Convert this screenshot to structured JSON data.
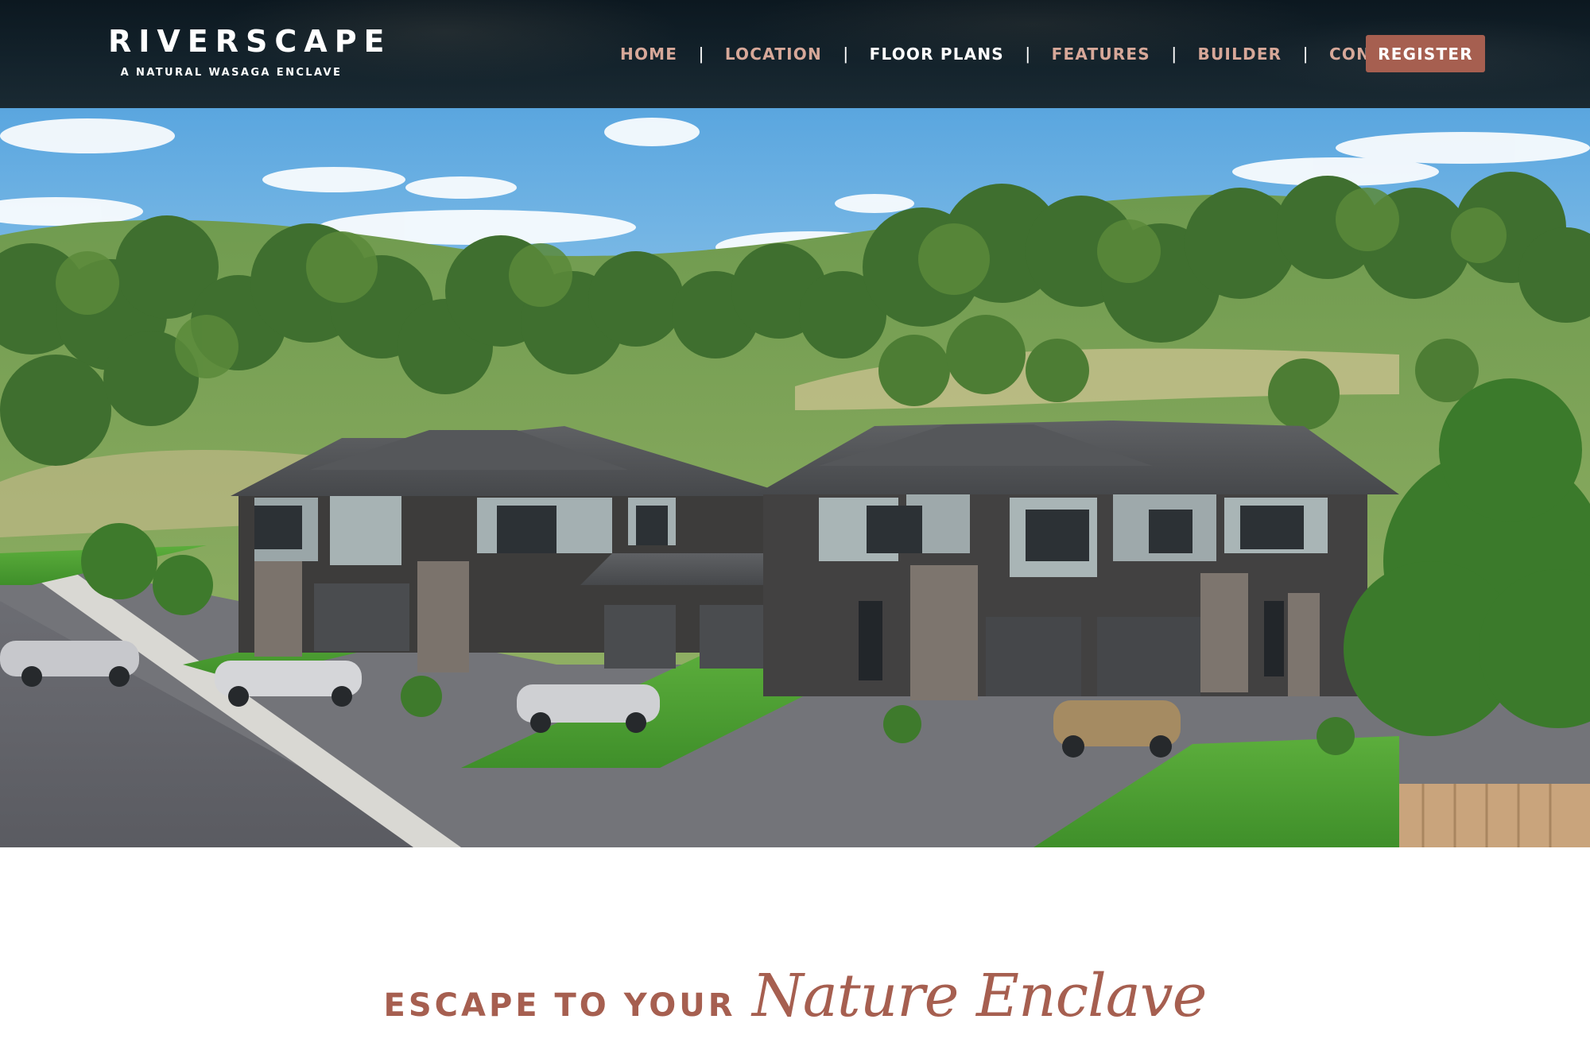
{
  "brand": {
    "name": "RIVERSCAPE",
    "tagline": "A NATURAL WASAGA ENCLAVE"
  },
  "nav": {
    "items": [
      {
        "label": "HOME"
      },
      {
        "label": "LOCATION"
      },
      {
        "label": "FLOOR PLANS"
      },
      {
        "label": "FEATURES"
      },
      {
        "label": "BUILDER"
      },
      {
        "label": "CONTACT"
      }
    ],
    "active": "FLOOR PLANS",
    "separator": "|",
    "register_label": "REGISTER"
  },
  "hero": {
    "image": "townhome-row-rendering"
  },
  "intro": {
    "kicker": "ESCAPE TO YOUR",
    "headline": "Nature Enclave"
  },
  "colors": {
    "header_bg": "#13222b",
    "accent": "#a65f50",
    "nav_text": "#d7a899",
    "nav_active": "#ffffff"
  }
}
